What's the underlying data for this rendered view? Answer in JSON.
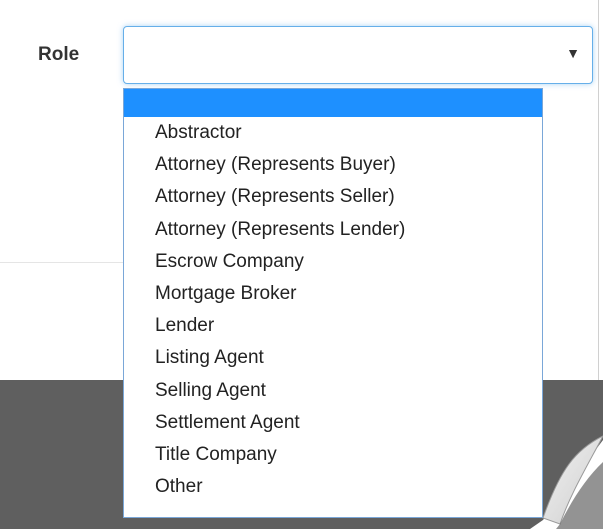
{
  "form": {
    "role_label": "Role",
    "role_select": {
      "value": "",
      "caret": "▼"
    }
  },
  "dropdown": {
    "highlighted_option": "",
    "highlight_color": "#1e90ff",
    "options": [
      "Abstractor",
      "Attorney (Represents Buyer)",
      "Attorney (Represents Seller)",
      "Attorney (Represents Lender)",
      "Escrow Company",
      "Mortgage Broker",
      "Lender",
      "Listing Agent",
      "Selling Agent",
      "Settlement Agent",
      "Title Company",
      "Other"
    ]
  },
  "colors": {
    "focus_border": "#66afe9",
    "backdrop": "#5f5f5f"
  }
}
